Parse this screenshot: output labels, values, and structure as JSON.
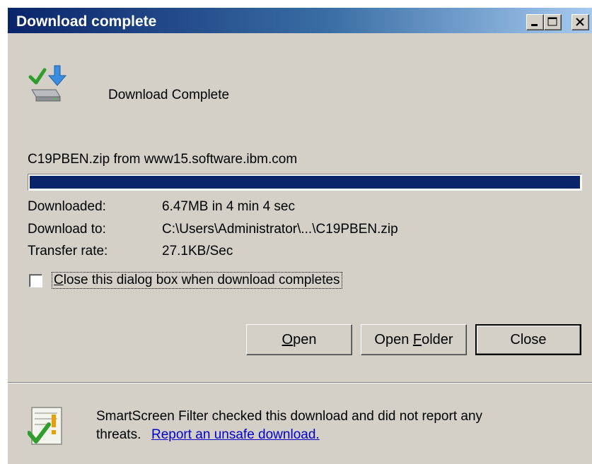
{
  "window": {
    "title": "Download complete",
    "controls": {
      "minimize": "minimize",
      "maximize": "maximize",
      "close": "close"
    }
  },
  "header": {
    "status": "Download Complete",
    "icon": "download-complete-icon"
  },
  "file": {
    "source": "C19PBEN.zip from www15.software.ibm.com"
  },
  "progress": {
    "percent": 100,
    "color": "#0a246a"
  },
  "details": {
    "downloaded_label": "Downloaded:",
    "downloaded_value": "6.47MB in 4 min 4 sec",
    "download_to_label": "Download to:",
    "download_to_value": "C:\\Users\\Administrator\\...\\C19PBEN.zip",
    "transfer_rate_label": "Transfer rate:",
    "transfer_rate_value": "27.1KB/Sec"
  },
  "checkbox": {
    "checked": false,
    "label_prefix": "",
    "label_accel": "C",
    "label_rest": "lose this dialog box when download completes"
  },
  "buttons": {
    "open_accel": "O",
    "open_rest": "pen",
    "open_folder_pre": "Open ",
    "open_folder_accel": "F",
    "open_folder_rest": "older",
    "close": "Close"
  },
  "smartscreen": {
    "message": "SmartScreen Filter checked this download and did not report any",
    "message_line2": "threats.",
    "link": "Report an unsafe download.",
    "icon": "smartscreen-shield-icon"
  }
}
